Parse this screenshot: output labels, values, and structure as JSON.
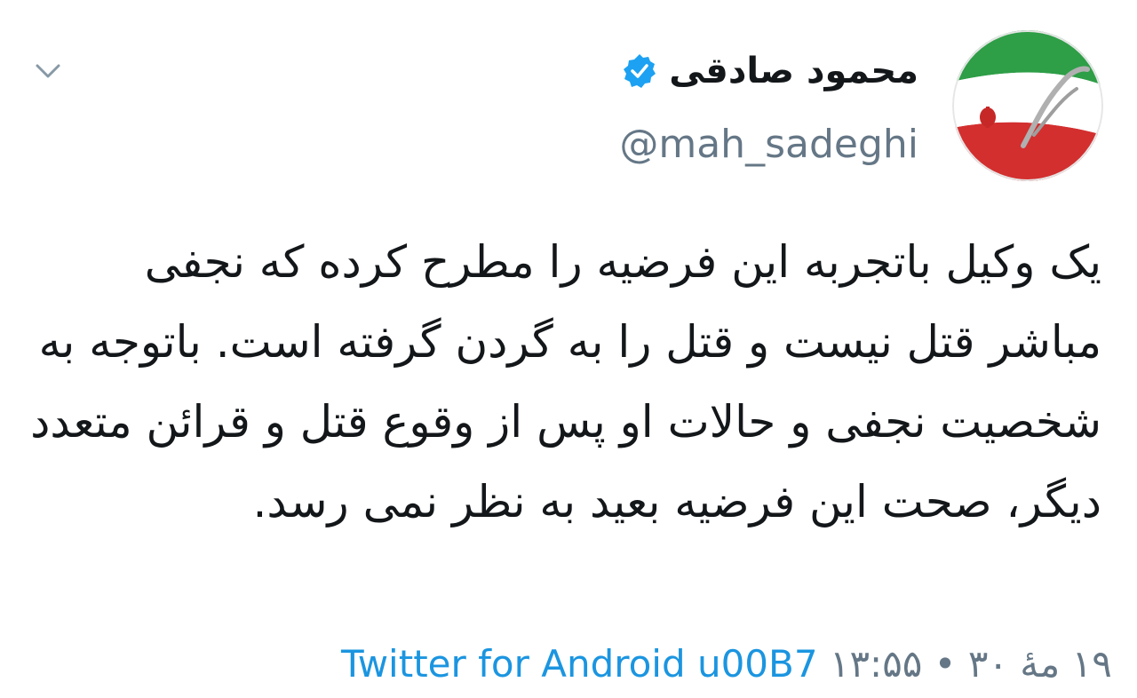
{
  "tweet": {
    "display_name": "محمود صادقی",
    "handle": "@mah_sadeghi",
    "verified": true,
    "body": "یک وکیل باتجربه این فرضیه را مطرح کرده که نجفی مباشر قتل نیست و قتل را به گردن گرفته است. باتوجه به شخصیت نجفی و حالات او پس از وقوع قتل و قرائن متعدد دیگر، صحت این فرضیه بعید به نظر نمی رسد.",
    "client": "Twitter for Android",
    "separator": "u00B7",
    "time": "۱۹ مهٔ ۳۰ • ۱۳:۵۵"
  },
  "icons": {
    "menu": "chevron-down-icon",
    "verified": "verified-badge-icon",
    "avatar": "flag-avatar"
  },
  "colors": {
    "link": "#1b95e0",
    "muted": "#657786",
    "text": "#14171a",
    "verified": "#1da1f2"
  }
}
